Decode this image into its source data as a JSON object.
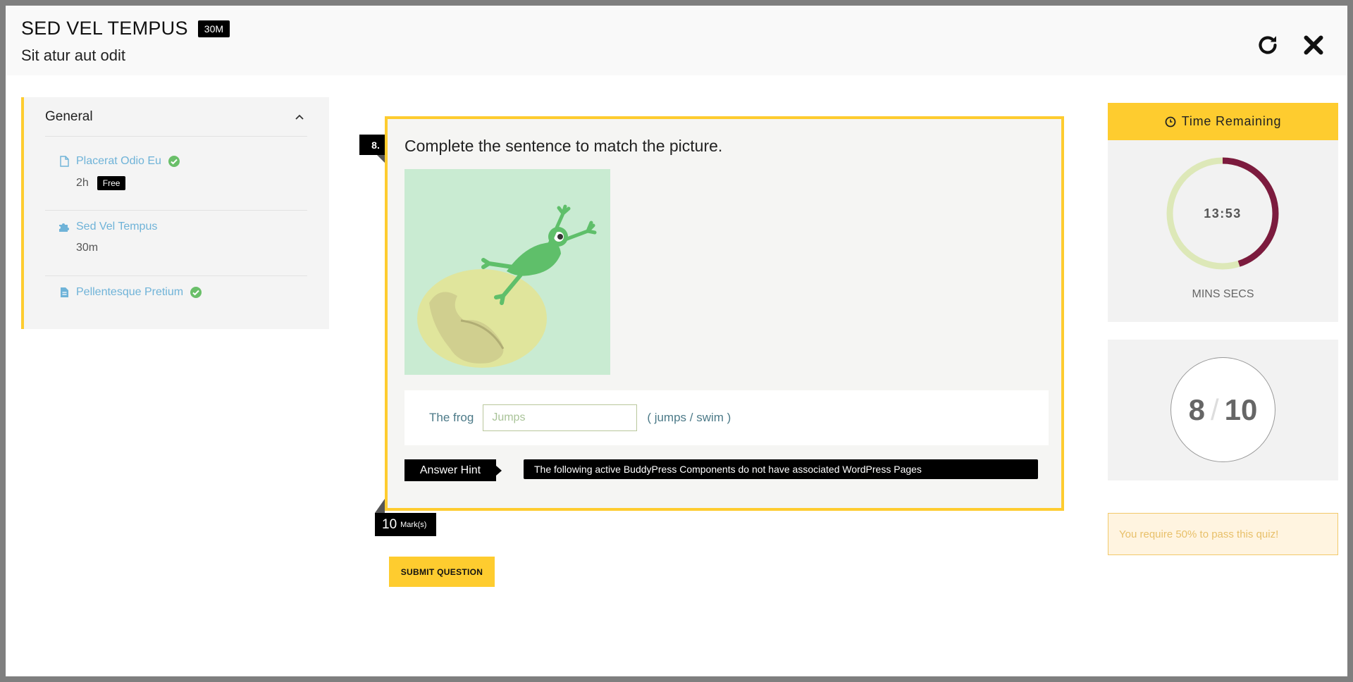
{
  "header": {
    "title": "SED VEL TEMPUS",
    "duration_badge": "30M",
    "subtitle": "Sit atur aut odit"
  },
  "sidebar": {
    "section_label": "General",
    "lessons": [
      {
        "title": "Placerat Odio Eu",
        "duration": "2h",
        "badge": "Free",
        "completed": true,
        "icon": "file-icon"
      },
      {
        "title": "Sed Vel Tempus",
        "duration": "30m",
        "completed": false,
        "icon": "puzzle-icon"
      },
      {
        "title": "Pellentesque Pretium",
        "completed": true,
        "icon": "document-icon"
      }
    ]
  },
  "question": {
    "number": "8.",
    "text": "Complete the sentence to match the picture.",
    "fill_prefix": "The frog",
    "input_value": "",
    "input_placeholder": "Jumps",
    "options": "( jumps / swim )",
    "hint_label": "Answer Hint",
    "hint_text": "The following active BuddyPress Components do not have associated WordPress Pages",
    "marks_value": "10",
    "marks_label": "Mark(s)",
    "submit_label": "SUBMIT QUESTION"
  },
  "timer": {
    "heading": "Time Remaining",
    "value": "13:53",
    "units": "MINS SECS",
    "remaining_fraction": 0.45
  },
  "score": {
    "current": "8",
    "separator": "/",
    "total": "10"
  },
  "pass_note": "You require 50% to pass this quiz!",
  "colors": {
    "accent": "#fecc2f",
    "timer_progress": "#7c1b3e",
    "timer_track": "#dde8b8",
    "link": "#6fb3d8",
    "check": "#6abf69"
  }
}
